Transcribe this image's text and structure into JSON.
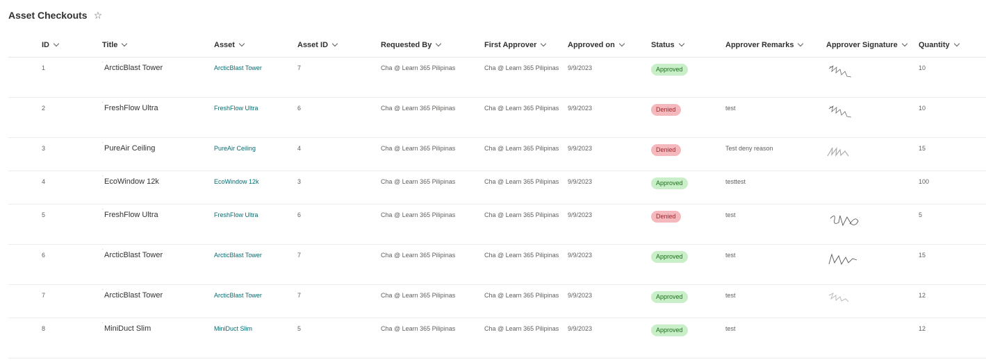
{
  "page": {
    "title": "Asset Checkouts",
    "favorite_icon": "star-outline-icon"
  },
  "columns": [
    {
      "label": "ID"
    },
    {
      "label": "Title"
    },
    {
      "label": "Asset"
    },
    {
      "label": "Asset ID"
    },
    {
      "label": "Requested By"
    },
    {
      "label": "First Approver"
    },
    {
      "label": "Approved on"
    },
    {
      "label": "Status"
    },
    {
      "label": "Approver Remarks"
    },
    {
      "label": "Approver Signature"
    },
    {
      "label": "Quantity"
    }
  ],
  "status_colors": {
    "approved_bg": "#c8efc8",
    "approved_text": "#1b6e1b",
    "denied_bg": "#f4b8bd",
    "denied_text": "#a4262c",
    "link": "#036c70"
  },
  "rows": [
    {
      "id": "1",
      "title": "ArcticBlast Tower",
      "asset": "ArcticBlast Tower",
      "asset_id": "7",
      "requested_by": "Cha @ Learn 365 Pilipinas",
      "first_approver": "Cha @ Learn 365 Pilipinas",
      "approved_on": "9/9/2023",
      "status": "Approved",
      "remarks": "",
      "signature": "signature-a",
      "quantity": "10"
    },
    {
      "id": "2",
      "title": "FreshFlow Ultra",
      "asset": "FreshFlow Ultra",
      "asset_id": "6",
      "requested_by": "Cha @ Learn 365 Pilipinas",
      "first_approver": "Cha @ Learn 365 Pilipinas",
      "approved_on": "9/9/2023",
      "status": "Denied",
      "remarks": "test",
      "signature": "signature-a",
      "quantity": "10"
    },
    {
      "id": "3",
      "title": "PureAir Ceiling",
      "asset": "PureAir Ceiling",
      "asset_id": "4",
      "requested_by": "Cha @ Learn 365 Pilipinas",
      "first_approver": "Cha @ Learn 365 Pilipinas",
      "approved_on": "9/9/2023",
      "status": "Denied",
      "remarks": "Test deny reason",
      "signature": "signature-b",
      "quantity": "15"
    },
    {
      "id": "4",
      "title": "EcoWindow 12k",
      "asset": "EcoWindow 12k",
      "asset_id": "3",
      "requested_by": "Cha @ Learn 365 Pilipinas",
      "first_approver": "Cha @ Learn 365 Pilipinas",
      "approved_on": "9/9/2023",
      "status": "Approved",
      "remarks": "testtest",
      "signature": "",
      "quantity": "100"
    },
    {
      "id": "5",
      "title": "FreshFlow Ultra",
      "asset": "FreshFlow Ultra",
      "asset_id": "6",
      "requested_by": "Cha @ Learn 365 Pilipinas",
      "first_approver": "Cha @ Learn 365 Pilipinas",
      "approved_on": "9/9/2023",
      "status": "Denied",
      "remarks": "test",
      "signature": "signature-c",
      "quantity": "5"
    },
    {
      "id": "6",
      "title": "ArcticBlast Tower",
      "asset": "ArcticBlast Tower",
      "asset_id": "7",
      "requested_by": "Cha @ Learn 365 Pilipinas",
      "first_approver": "Cha @ Learn 365 Pilipinas",
      "approved_on": "9/9/2023",
      "status": "Approved",
      "remarks": "test",
      "signature": "signature-d",
      "quantity": "15"
    },
    {
      "id": "7",
      "title": "ArcticBlast Tower",
      "asset": "ArcticBlast Tower",
      "asset_id": "7",
      "requested_by": "Cha @ Learn 365 Pilipinas",
      "first_approver": "Cha @ Learn 365 Pilipinas",
      "approved_on": "9/9/2023",
      "status": "Approved",
      "remarks": "test",
      "signature": "signature-e",
      "quantity": "12"
    },
    {
      "id": "8",
      "title": "MiniDuct Slim",
      "asset": "MiniDuct Slim",
      "asset_id": "5",
      "requested_by": "Cha @ Learn 365 Pilipinas",
      "first_approver": "Cha @ Learn 365 Pilipinas",
      "approved_on": "9/9/2023",
      "status": "Approved",
      "remarks": "test",
      "signature": "",
      "quantity": "12"
    }
  ]
}
